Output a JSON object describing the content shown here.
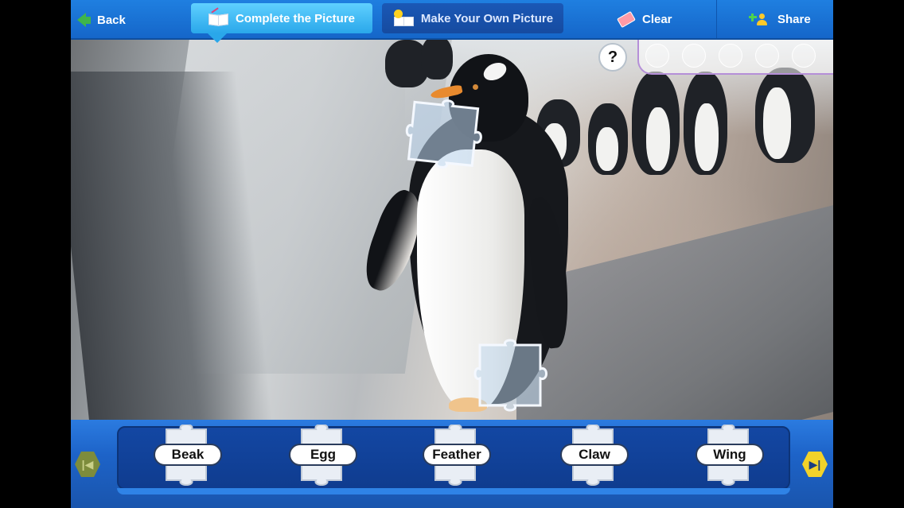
{
  "toolbar": {
    "back_label": "Back",
    "tabs": [
      {
        "label": "Complete the Picture",
        "active": true
      },
      {
        "label": "Make Your Own Picture",
        "active": false
      }
    ],
    "clear_label": "Clear",
    "share_label": "Share"
  },
  "help": {
    "label": "?"
  },
  "progress": {
    "filled": 0,
    "total": 5
  },
  "word_pieces": [
    {
      "label": "Beak"
    },
    {
      "label": "Egg"
    },
    {
      "label": "Feather"
    },
    {
      "label": "Claw"
    },
    {
      "label": "Wing"
    }
  ],
  "colors": {
    "toolbar_blue": "#1566c9",
    "active_tab": "#2aa7ea",
    "tray_blue": "#0f3c8f",
    "next_arrow": "#f2d22a",
    "prev_arrow": "#7d8c3c"
  },
  "icons": {
    "back": "back-arrow-icon",
    "complete_tab": "book-icon",
    "make_tab": "smiley-book-icon",
    "clear": "eraser-icon",
    "share": "add-person-icon",
    "prev": "chevron-left-icon",
    "next": "chevron-right-icon"
  }
}
